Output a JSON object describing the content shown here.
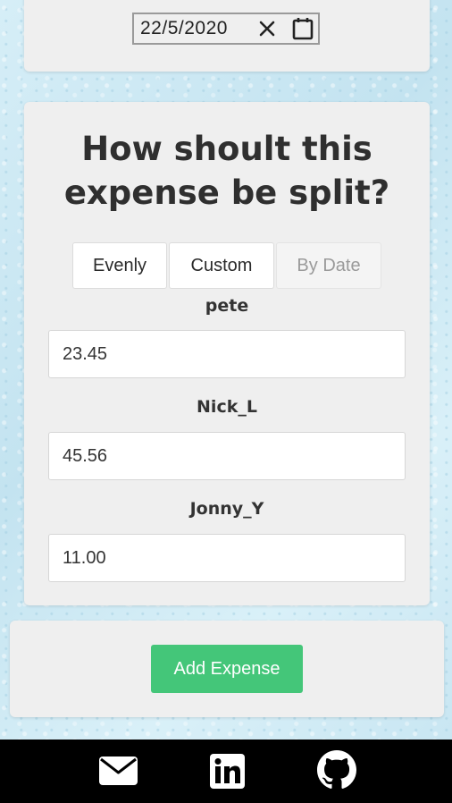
{
  "date_card": {
    "date_value": "22/5/2020",
    "clear_icon": "close-icon",
    "calendar_icon": "calendar-icon"
  },
  "split": {
    "title": "How shoult this expense be split?",
    "tabs": [
      {
        "label": "Evenly",
        "state": "normal"
      },
      {
        "label": "Custom",
        "state": "normal"
      },
      {
        "label": "By Date",
        "state": "disabled"
      }
    ],
    "people": [
      {
        "name": "pete",
        "amount": "23.45"
      },
      {
        "name": "Nick_L",
        "amount": "45.56"
      },
      {
        "name": "Jonny_Y",
        "amount": "11.00"
      }
    ]
  },
  "actions": {
    "add_expense_label": "Add Expense"
  },
  "footer": {
    "icons": [
      "mail-icon",
      "linkedin-icon",
      "github-icon"
    ]
  },
  "colors": {
    "accent_green": "#44c679",
    "card_bg": "#efefef",
    "footer_bg": "#000000",
    "page_bg": "#cfe9f3"
  }
}
